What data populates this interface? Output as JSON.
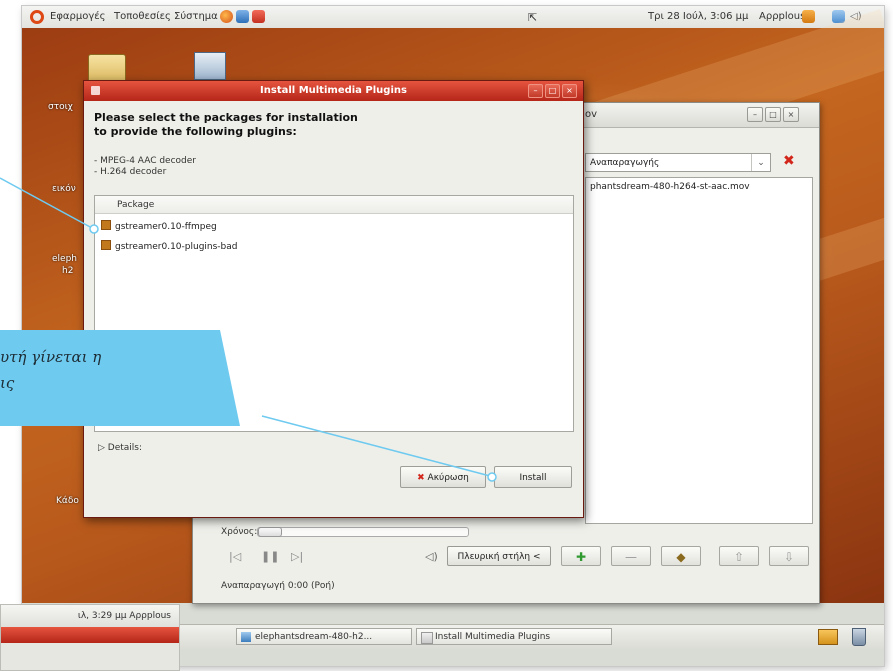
{
  "top_panel": {
    "menu_applications": "Εφαρμογές",
    "menu_places": "Τοποθεσίες",
    "menu_system": "Σύστημα",
    "clock": "Τρι 28 Ιούλ, 3:06 μμ",
    "user": "Αρρplous"
  },
  "desktop_icons": [
    {
      "label": "στοιχ"
    },
    {
      "label": "εικόν"
    },
    {
      "label": "eleph"
    },
    {
      "label": "h2"
    },
    {
      "label": "Κάδο"
    }
  ],
  "player": {
    "title_fragment": "ov",
    "combo_value": "Αναπαραγωγής",
    "playlist_item": "phantsdream-480-h264-st-aac.mov",
    "time_label": "Χρόνος:",
    "sidebar_button": "Πλευρική στήλη <",
    "status": "Αναπαραγωγή   0:00 (Ροή)"
  },
  "dialog": {
    "title": "Install Multimedia Plugins",
    "heading_line1": "Please select the packages for installation",
    "heading_line2": "to provide the following plugins:",
    "plugins": [
      "- MPEG-4 AAC decoder",
      "- H.264 decoder"
    ],
    "column_header": "Package",
    "packages": [
      "gstreamer0.10-ffmpeg",
      "gstreamer0.10-plugins-bad"
    ],
    "details_label": "Details:",
    "cancel_label": "Ακύρωση",
    "install_label": "Install"
  },
  "taskbar": {
    "task1": "elephantsdream-480-h2...",
    "task2": "Install Multimedia Plugins"
  },
  "callout": {
    "line1": "υτή γίνεται η",
    "line2": "ις"
  },
  "inset": {
    "panel_text": "ιλ, 3:29 μμ Αρρplous"
  },
  "colors": {
    "accent_red": "#c8321f",
    "callout_blue": "#6fcaf0",
    "ubuntu_orange": "#dd4814"
  }
}
